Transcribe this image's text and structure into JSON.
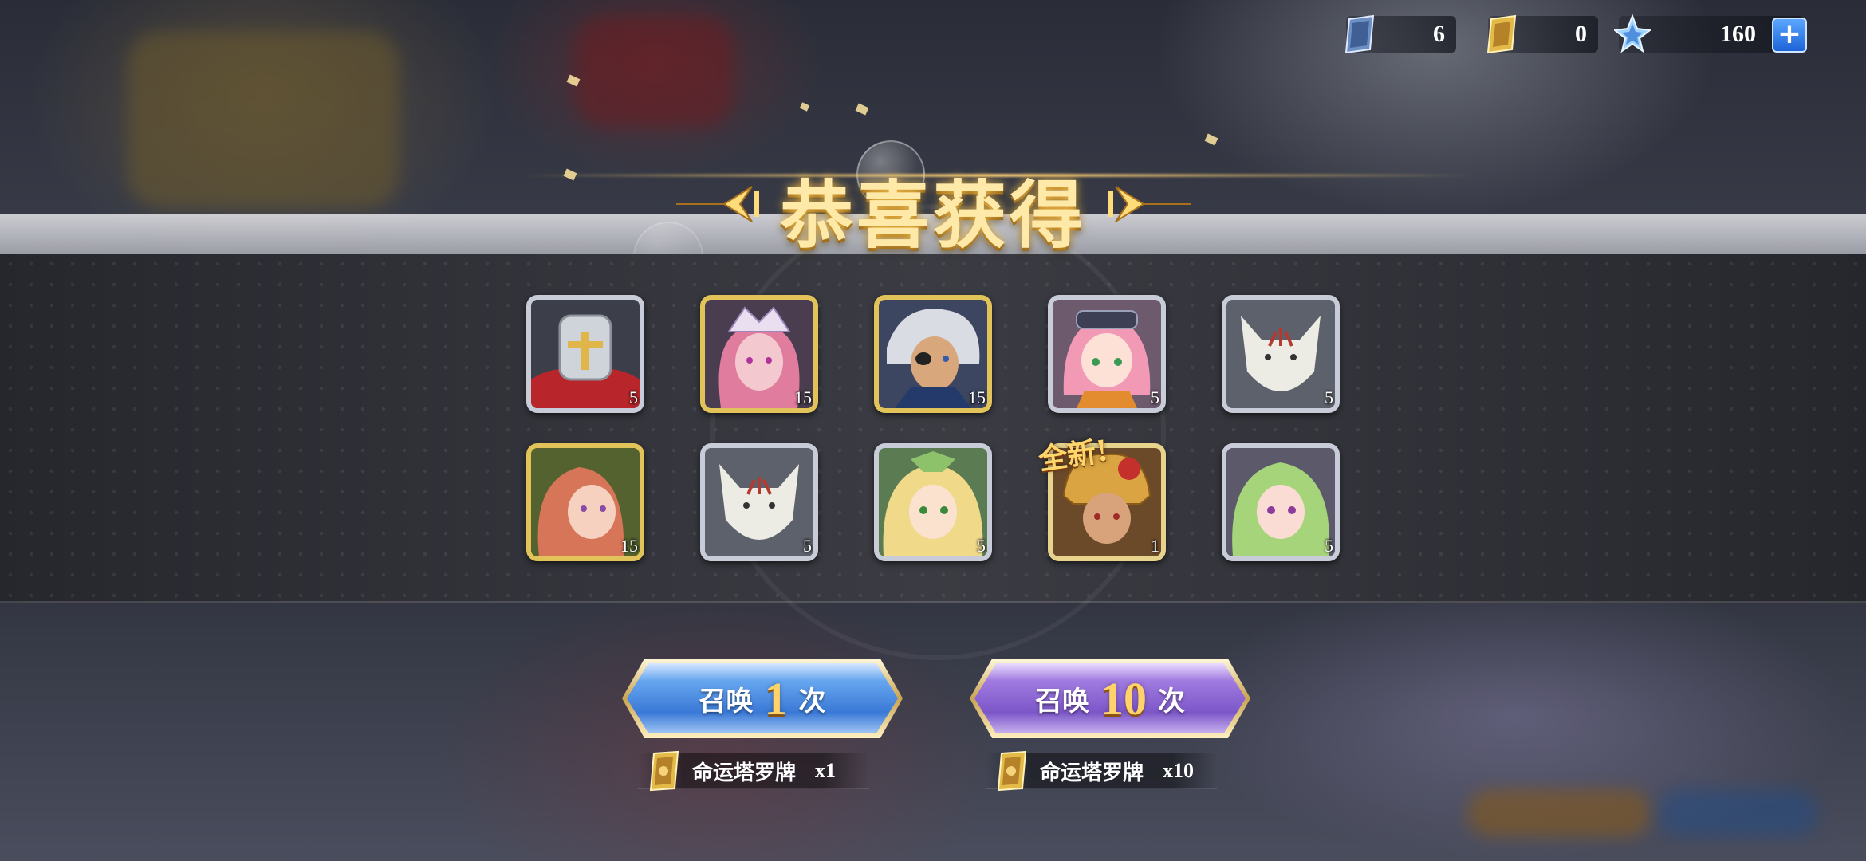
{
  "currency": {
    "tickets_blue": "6",
    "tarot_cards": "0",
    "star_gems": "160",
    "add_label": "+"
  },
  "banner": {
    "title": "恭喜获得"
  },
  "rewards": [
    {
      "name": "helmet-knight",
      "frame": "silver",
      "count": "5",
      "is_new": false
    },
    {
      "name": "pink-elf-hat",
      "frame": "gold",
      "count": "15",
      "is_new": false
    },
    {
      "name": "eyepatch-swordsman",
      "frame": "gold",
      "count": "15",
      "is_new": false
    },
    {
      "name": "pink-goggles-girl",
      "frame": "silver",
      "count": "5",
      "is_new": false
    },
    {
      "name": "white-wolf",
      "frame": "silver",
      "count": "5",
      "is_new": false
    },
    {
      "name": "red-hair-girl",
      "frame": "gold",
      "count": "15",
      "is_new": false
    },
    {
      "name": "white-wolf-2",
      "frame": "silver",
      "count": "5",
      "is_new": false
    },
    {
      "name": "blonde-elf",
      "frame": "silver",
      "count": "5",
      "is_new": false
    },
    {
      "name": "golden-warrior",
      "frame": "rainbow",
      "count": "1",
      "is_new": true
    },
    {
      "name": "green-hair-girl",
      "frame": "silver",
      "count": "5",
      "is_new": false
    }
  ],
  "new_tag": "全新!",
  "summon": {
    "single": {
      "prefix": "召唤",
      "count": "1",
      "suffix": "次",
      "cost_item": "命运塔罗牌",
      "cost_mult": "x1"
    },
    "multi": {
      "prefix": "召唤",
      "count": "10",
      "suffix": "次",
      "cost_item": "命运塔罗牌",
      "cost_mult": "x10"
    }
  },
  "colors": {
    "gold_frame": "#e2c35a",
    "silver_frame": "#c7ccd8",
    "single_button": "#3a79d6",
    "multi_button": "#7c56c8",
    "title": "#ffe9a8"
  }
}
